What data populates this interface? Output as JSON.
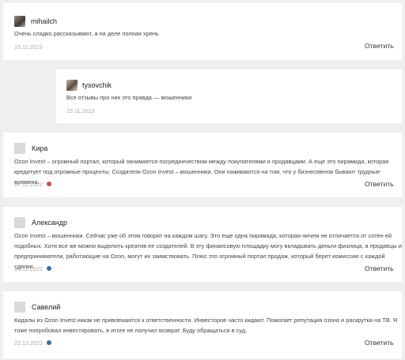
{
  "comments": [
    {
      "author": "mihailch",
      "text": [
        "Очень сладко рассказывают, а на деле полная хрень"
      ],
      "date": "15.11.2023",
      "reply": "Ответить"
    },
    {
      "author": "tysovchik",
      "text": [
        "Все отзывы про них это правда — мошенники"
      ],
      "date": "15.11.2023",
      "reply": ""
    },
    {
      "author": "Кира",
      "text": [
        "Ozon Invest – огромный портал, который занимается посредничеством между покупателями и продавцами. А еще это пирамида, которая",
        "кредитует под огромные проценты. Создатели Ozon Invest – мошенники. Они наживаются на том, что у бизнесменов бывают трудные времена."
      ],
      "date": "27.12.2022",
      "flag": "red",
      "reply": "Ответить"
    },
    {
      "author": "Александр",
      "text": [
        "Ozon Invest – мошенники. Сейчас уже об этом говорят на каждом шагу. Это еще одна пирамида, которая ничем не отличается от сотен ей",
        "подобных. Хотя все же можно выделить креатив ее создателей. В эту финансовую площадку могу вкладывать деньги физлица, а продавцы и",
        "предприниматели, работающие на Ozon, могут их заимствовать. Плюс это огромный портал продаж, который берет комиссию с каждой сделки."
      ],
      "date": "24.12.2022",
      "flag": "blue",
      "reply": "Ответить"
    },
    {
      "author": "Савелий",
      "text": [
        "Кидалы из Ozon Invest никак не привлекаются к ответственности. Инвесторов часто кидают. Помогает репутация озона и раскрутка на ТВ. Я",
        "тоже попробовал инвестировать, в итоге не получил возврат. Буду обращаться в суд."
      ],
      "date": "22.12.2022",
      "flag": "blue",
      "reply": "Ответить"
    }
  ],
  "colors": {
    "red_flag": "#d64a3a",
    "blue_flag": "#2f6fb3"
  }
}
